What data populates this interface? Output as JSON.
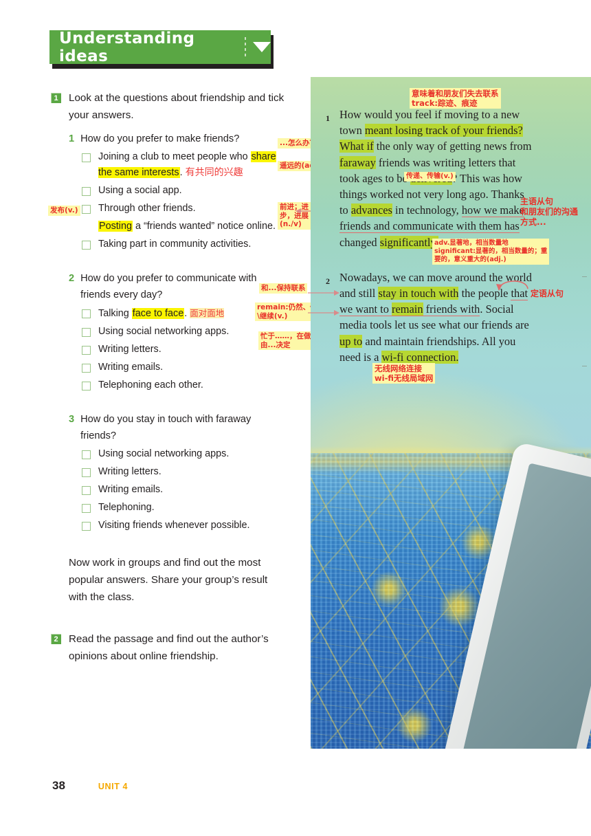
{
  "header": {
    "title": "Understanding ideas",
    "caret_icon": "chevron-down-icon"
  },
  "tasks": [
    {
      "number": "1",
      "text": "Look at the questions about friendship and tick your answers."
    },
    {
      "number": "2",
      "text": "Read the passage and find out the author’s opinions about online friendship."
    }
  ],
  "questions": [
    {
      "number": "1",
      "text": "How do you prefer to make friends?",
      "options": [
        {
          "pre": "Joining a club to meet people who ",
          "hl": "share the same interests",
          "post": ".",
          "cn": "有共同的兴趣",
          "checkbox": true
        },
        {
          "pre": "Using a social app.",
          "hl": "",
          "post": "",
          "cn": "",
          "checkbox": true
        },
        {
          "pre": "Through other friends.",
          "hl": "",
          "post": "",
          "cn": "",
          "checkbox": true
        },
        {
          "pre": "",
          "hl": "Posting",
          "post": " a “friends wanted” notice online.",
          "cn": "",
          "checkbox": false
        },
        {
          "pre": "Taking part in community activities.",
          "hl": "",
          "post": "",
          "cn": "",
          "checkbox": true
        }
      ]
    },
    {
      "number": "2",
      "text": "How do you prefer to communicate with friends every day?",
      "options": [
        {
          "pre": "Talking ",
          "hl": "face to face",
          "post": ".",
          "cn": "面对面地",
          "checkbox": true
        },
        {
          "pre": "Using social networking apps.",
          "hl": "",
          "post": "",
          "cn": "",
          "checkbox": true
        },
        {
          "pre": "Writing letters.",
          "hl": "",
          "post": "",
          "cn": "",
          "checkbox": true
        },
        {
          "pre": "Writing emails.",
          "hl": "",
          "post": "",
          "cn": "",
          "checkbox": true
        },
        {
          "pre": "Telephoning each other.",
          "hl": "",
          "post": "",
          "cn": "",
          "checkbox": true
        }
      ]
    },
    {
      "number": "3",
      "text": "How do you stay in touch with faraway friends?",
      "options": [
        {
          "pre": "Using social networking apps.",
          "hl": "",
          "post": "",
          "cn": "",
          "checkbox": true
        },
        {
          "pre": "Writing letters.",
          "hl": "",
          "post": "",
          "cn": "",
          "checkbox": true
        },
        {
          "pre": "Writing emails.",
          "hl": "",
          "post": "",
          "cn": "",
          "checkbox": true
        },
        {
          "pre": "Telephoning.",
          "hl": "",
          "post": "",
          "cn": "",
          "checkbox": true
        },
        {
          "pre": "Visiting friends whenever possible.",
          "hl": "",
          "post": "",
          "cn": "",
          "checkbox": true
        }
      ]
    }
  ],
  "group_work": "Now work in groups and find out the most popular answers. Share your group’s result with the class.",
  "left_notes": {
    "posting": "发布(v.)",
    "what_if": "...怎么办？",
    "faraway": "遥远的(adj.)",
    "advances": "前进；进\n步，进展\n(n./v)",
    "stay_in_touch": "和...保持联系",
    "remain": "remain:仍然、仍旧\n\\继续(v.)",
    "up_to": "忙于……，在做……\n由...决定"
  },
  "passage": {
    "paragraphs": [
      {
        "number": "1",
        "lines": [
          [
            {
              "t": "How would you feel if moving to a new",
              "s": "plain"
            }
          ],
          [
            {
              "t": "town ",
              "s": "plain"
            },
            {
              "t": "meant losing track of your friends?",
              "s": "green"
            }
          ],
          [
            {
              "t": "What if",
              "s": "green"
            },
            {
              "t": " the only way of getting news from",
              "s": "plain"
            }
          ],
          [
            {
              "t": "faraway",
              "s": "green"
            },
            {
              "t": " friends was writing letters that",
              "s": "plain"
            }
          ],
          [
            {
              "t": "took ages to be ",
              "s": "plain"
            },
            {
              "t": "delivered",
              "s": "green"
            },
            {
              "t": "? This was how",
              "s": "plain"
            }
          ],
          [
            {
              "t": "things worked not very long ago. Thanks",
              "s": "plain"
            }
          ],
          [
            {
              "t": "to ",
              "s": "plain"
            },
            {
              "t": "advances",
              "s": "green"
            },
            {
              "t": " in technology, ",
              "s": "plain"
            },
            {
              "t": "how we make",
              "s": "underline"
            }
          ],
          [
            {
              "t": "friends and communicate with them has",
              "s": "underline"
            }
          ],
          [
            {
              "t": "changed ",
              "s": "plain"
            },
            {
              "t": "significantly.",
              "s": "green"
            }
          ]
        ]
      },
      {
        "number": "2",
        "lines": [
          [
            {
              "t": "Nowadays, we can move around the world",
              "s": "plain"
            }
          ],
          [
            {
              "t": "and still ",
              "s": "plain"
            },
            {
              "t": "stay in touch with",
              "s": "green"
            },
            {
              "t": " the people ",
              "s": "plain"
            },
            {
              "t": "that",
              "s": "underline"
            }
          ],
          [
            {
              "t": "we want to ",
              "s": "underline"
            },
            {
              "t": "remain",
              "s": "green"
            },
            {
              "t": " friends with",
              "s": "underline"
            },
            {
              "t": ". Social",
              "s": "plain"
            }
          ],
          [
            {
              "t": "media tools let us see what our friends are",
              "s": "plain"
            }
          ],
          [
            {
              "t": "up to",
              "s": "green"
            },
            {
              "t": " and maintain friendships. All you",
              "s": "plain"
            }
          ],
          [
            {
              "t": "need is a ",
              "s": "plain"
            },
            {
              "t": "wi-fi connection.",
              "s": "green"
            }
          ]
        ]
      }
    ]
  },
  "passage_notes": {
    "track": "意味着和朋友们失去联系\ntrack:踪迹、痕迹",
    "delivered": "传递、传输(v.)",
    "subject_clause": "主语从句\n和朋友们的沟通\n方式...",
    "significantly": "adv.显著地，相当数量地\nsignificant:显著的，相当数量的；重\n要的，意义重大的(adj.)",
    "attributive_clause": "定语从句",
    "wifi": "无线网络连接\nwi-fi无线局域网"
  },
  "footer": {
    "page_number": "38",
    "unit": "UNIT 4"
  },
  "colors": {
    "green_banner": "#5aa744",
    "yellow_highlight": "#fbf500",
    "green_highlight": "#b7d732",
    "note_bg": "#fdf8a8",
    "note_text": "#e8312a",
    "unit_orange": "#f5a800"
  }
}
